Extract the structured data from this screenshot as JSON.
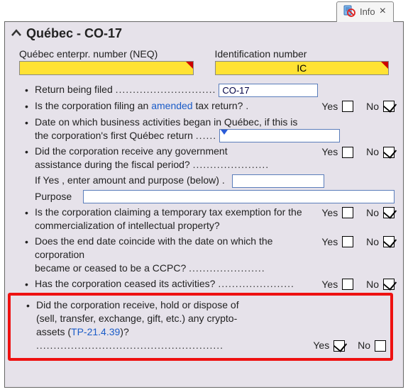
{
  "tab": {
    "label": "Info"
  },
  "section": {
    "title": "Québec - CO-17"
  },
  "fields": {
    "neq_label": "Québec enterpr. number (NEQ)",
    "neq_value": "",
    "idnum_label": "Identification number",
    "idnum_value": "IC"
  },
  "rows": {
    "return_label": "Return being filed",
    "return_value": "CO-17",
    "amended_pre": "Is the corporation filing an ",
    "amended_link": "amended",
    "amended_post": " tax return?",
    "date_label_a": "Date on which business activities began in Québec, if this is",
    "date_label_b": "the corporation's first Québec return",
    "govassist_a": "Did the corporation receive any government",
    "govassist_b": "assistance during the fiscal period?",
    "ifyes": "If Yes , enter amount and purpose (below) .",
    "purpose": "Purpose",
    "ipexempt_a": "Is the corporation claiming a temporary tax exemption for the",
    "ipexempt_b": "commercialization of intellectual property?",
    "enddate_a": "Does the end date coincide with the date on which the corporation",
    "enddate_b": "became or ceased to be a CCPC?",
    "ceased": "Has the corporation ceased its activities?",
    "crypto_a": "Did the corporation receive, hold or dispose of",
    "crypto_b": "(sell, transfer, exchange, gift, etc.) any crypto-",
    "crypto_c_pre": "assets (",
    "crypto_link": "TP-21.4.39",
    "crypto_c_post": ")?"
  },
  "labels": {
    "yes": "Yes",
    "no": "No"
  },
  "dots": {
    "d1": " .............................",
    "d2": " .",
    "d3": " ......",
    "d4": " ......................",
    "d5": " ......................",
    "d6": " ......................",
    "d7": " ......................................................"
  }
}
